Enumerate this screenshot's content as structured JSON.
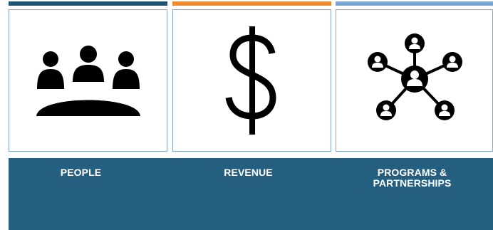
{
  "colors": {
    "bar_people": "#1f5475",
    "bar_revenue": "#f08a2c",
    "bar_programs": "#7aa6d6",
    "band": "#255f80",
    "icon": "#000000"
  },
  "cards": [
    {
      "icon": "meeting-people-icon",
      "label_lines": [
        "PEOPLE"
      ]
    },
    {
      "icon": "dollar-sign-icon",
      "label_lines": [
        "REVENUE"
      ]
    },
    {
      "icon": "network-icon",
      "label_lines": [
        "PROGRAMS &",
        "PARTNERSHIPS"
      ]
    }
  ]
}
